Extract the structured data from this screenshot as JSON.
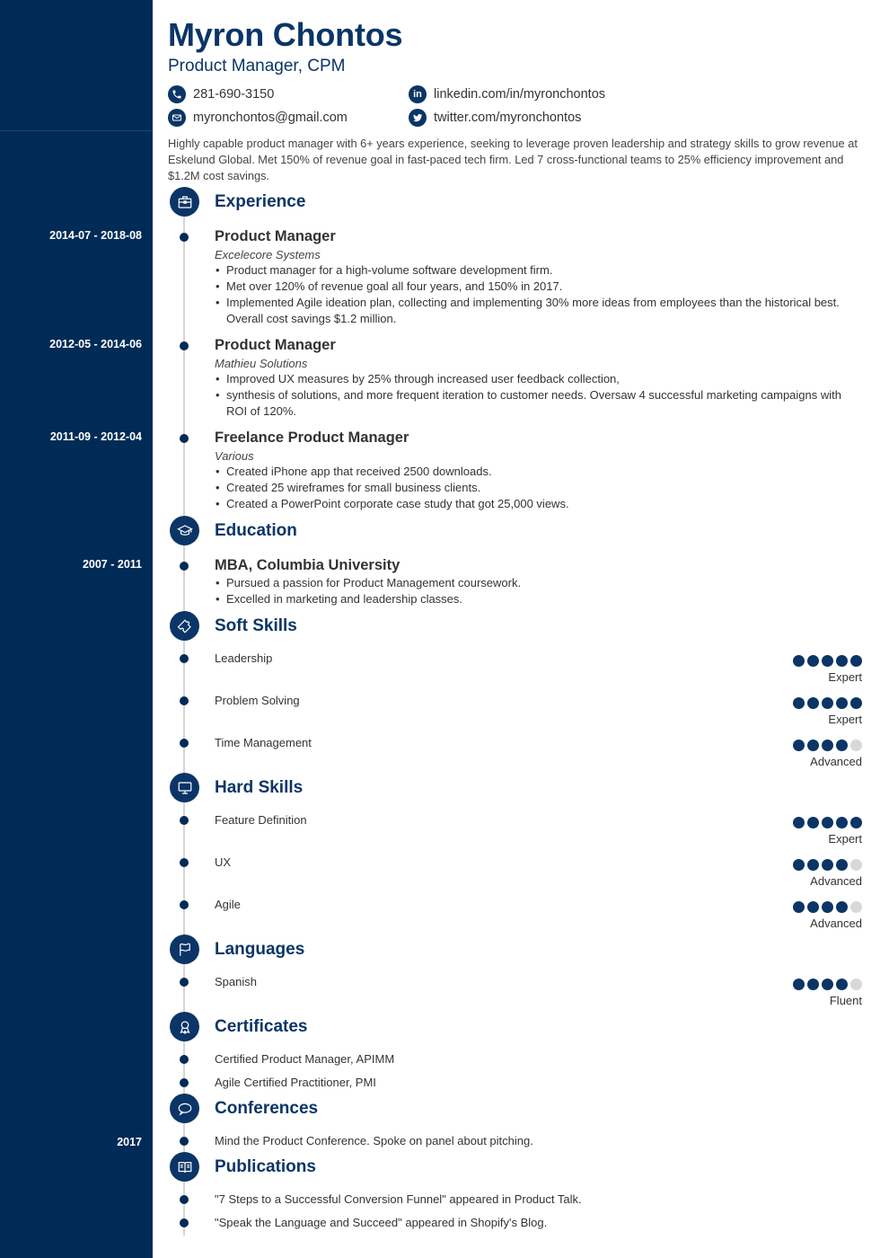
{
  "header": {
    "name": "Myron Chontos",
    "title": "Product Manager, CPM",
    "contacts": {
      "phone": "281-690-3150",
      "email": "myronchontos@gmail.com",
      "linkedin": "linkedin.com/in/myronchontos",
      "twitter": "twitter.com/myronchontos"
    },
    "summary": "Highly capable product manager with 6+ years experience, seeking to leverage proven leadership and strategy skills to grow revenue at Eskelund Global. Met 150% of revenue goal in fast-paced tech firm. Led 7 cross-functional teams to 25% efficiency improvement and $1.2M cost savings."
  },
  "theme": {
    "accent": "#0b3566",
    "sidebar": "#012b57"
  },
  "sections": {
    "experience": {
      "heading": "Experience",
      "icon": "briefcase-icon",
      "jobs": [
        {
          "dates": "2014-07 - 2018-08",
          "title": "Product Manager",
          "company": "Excelecore Systems",
          "bullets": [
            "Product manager for a high-volume software development firm.",
            "Met over 120% of revenue goal all four years, and 150% in 2017.",
            "Implemented Agile ideation plan, collecting and implementing 30% more ideas from employees than the historical best. Overall cost savings $1.2 million."
          ]
        },
        {
          "dates": "2012-05 - 2014-06",
          "title": "Product Manager",
          "company": "Mathieu Solutions",
          "bullets": [
            "Improved UX measures by 25% through increased user feedback collection,",
            "synthesis of solutions, and more frequent iteration to customer needs. Oversaw 4 successful marketing campaigns with ROI of 120%."
          ]
        },
        {
          "dates": "2011-09 - 2012-04",
          "title": "Freelance Product Manager",
          "company": "Various",
          "bullets": [
            "Created iPhone app that received 2500 downloads.",
            "Created 25 wireframes for small business clients.",
            "Created a PowerPoint corporate case study that got 25,000 views."
          ]
        }
      ]
    },
    "education": {
      "heading": "Education",
      "icon": "graduation-cap-icon",
      "items": [
        {
          "dates": "2007 - 2011",
          "title": "MBA, Columbia University",
          "bullets": [
            "Pursued a passion for Product Management coursework.",
            "Excelled in marketing and leadership classes."
          ]
        }
      ]
    },
    "soft_skills": {
      "heading": "Soft Skills",
      "icon": "puzzle-icon",
      "items": [
        {
          "name": "Leadership",
          "rating": 5,
          "max": 5,
          "level": "Expert"
        },
        {
          "name": "Problem Solving",
          "rating": 5,
          "max": 5,
          "level": "Expert"
        },
        {
          "name": "Time Management",
          "rating": 4,
          "max": 5,
          "level": "Advanced"
        }
      ]
    },
    "hard_skills": {
      "heading": "Hard Skills",
      "icon": "monitor-icon",
      "items": [
        {
          "name": "Feature Definition",
          "rating": 5,
          "max": 5,
          "level": "Expert"
        },
        {
          "name": "UX",
          "rating": 4,
          "max": 5,
          "level": "Advanced"
        },
        {
          "name": "Agile",
          "rating": 4,
          "max": 5,
          "level": "Advanced"
        }
      ]
    },
    "languages": {
      "heading": "Languages",
      "icon": "flag-icon",
      "items": [
        {
          "name": "Spanish",
          "rating": 4,
          "max": 5,
          "level": "Fluent"
        }
      ]
    },
    "certificates": {
      "heading": "Certificates",
      "icon": "award-icon",
      "items": [
        "Certified Product Manager, APIMM",
        "Agile Certified Practitioner, PMI"
      ]
    },
    "conferences": {
      "heading": "Conferences",
      "icon": "speech-bubble-icon",
      "items": [
        {
          "dates": "2017",
          "text": "Mind the Product Conference. Spoke on panel about pitching."
        }
      ]
    },
    "publications": {
      "heading": "Publications",
      "icon": "book-icon",
      "items": [
        "\"7 Steps to a Successful Conversion Funnel\" appeared in Product Talk.",
        "\"Speak the Language and Succeed\" appeared in Shopify's Blog."
      ]
    }
  }
}
